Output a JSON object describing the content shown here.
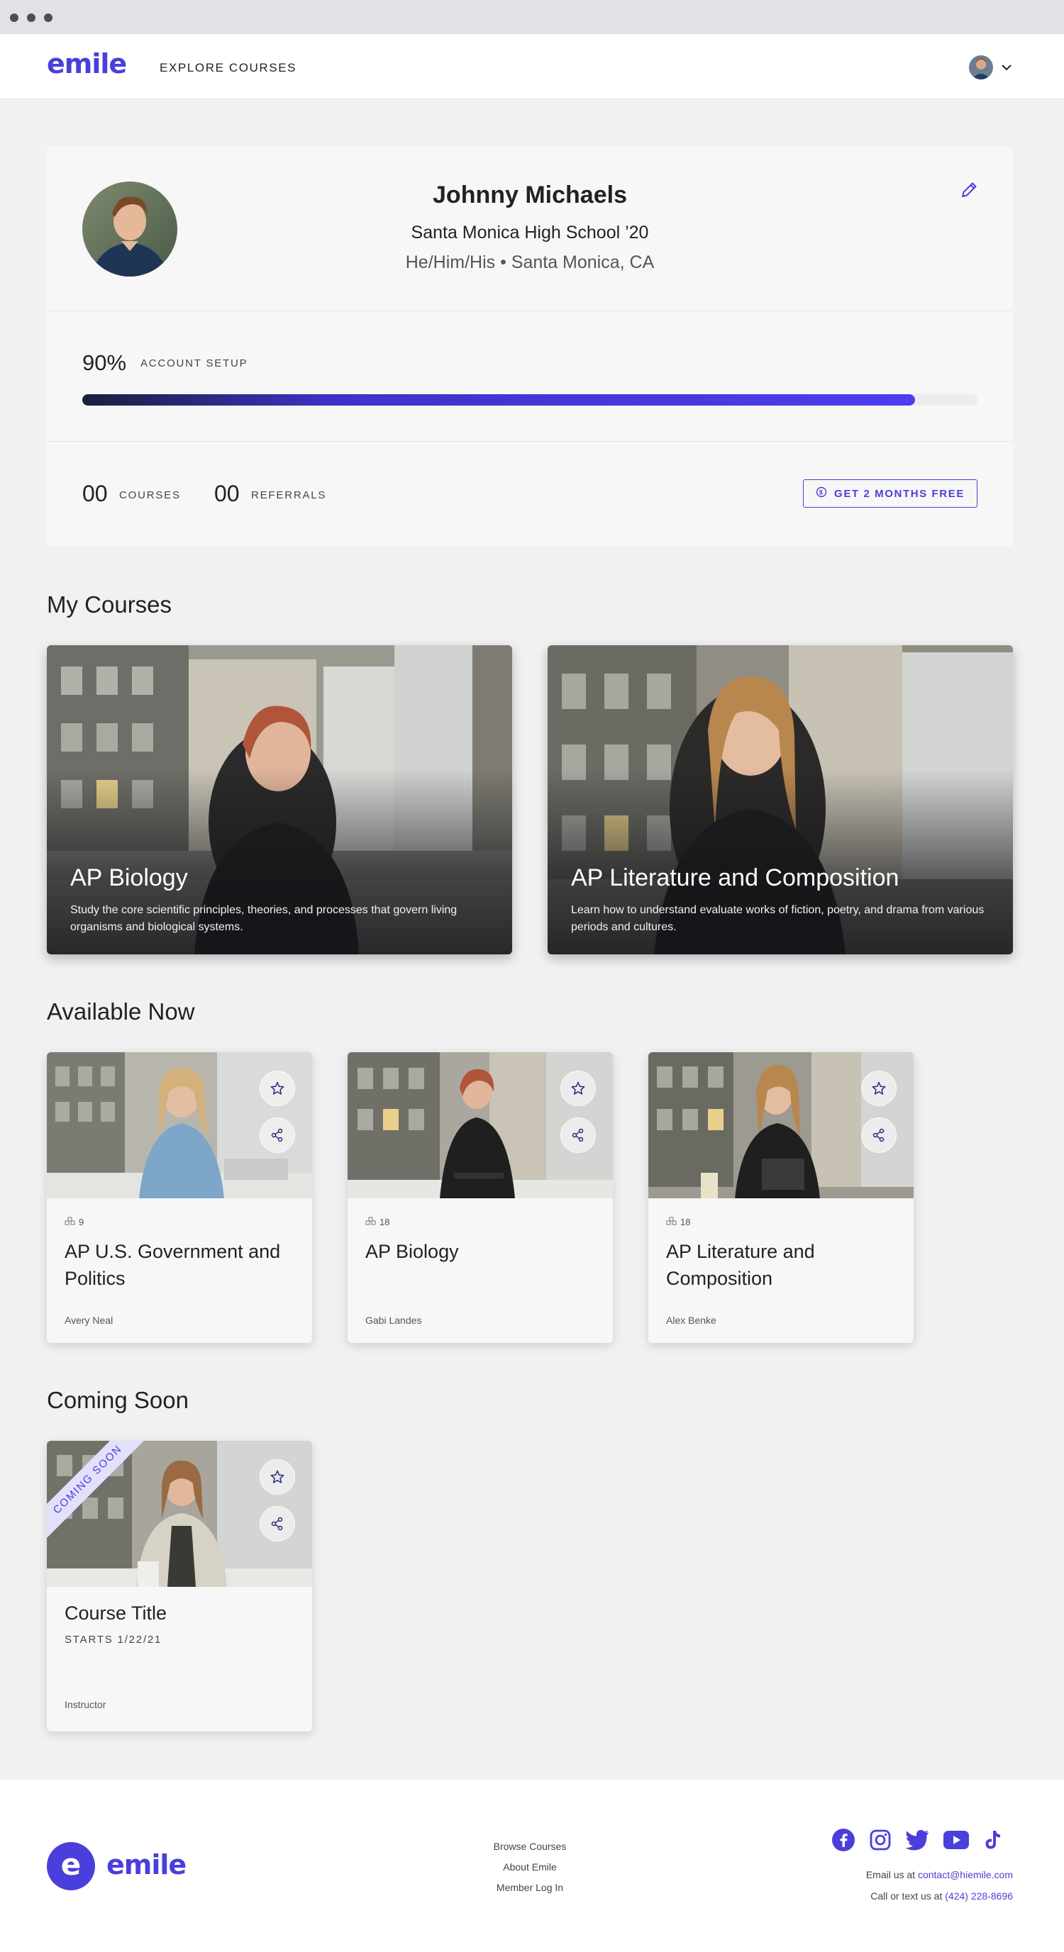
{
  "header": {
    "logo": "emile",
    "explore_label": "EXPLORE COURSES"
  },
  "profile": {
    "name": "Johnny Michaels",
    "school": "Santa Monica High School ’20",
    "pronouns_location": "He/Him/His • Santa Monica, CA",
    "setup_percent_label": "90%",
    "setup_percent": 0.93,
    "setup_label": "ACCOUNT SETUP",
    "courses_count": "00",
    "courses_label": "COURSES",
    "referrals_count": "00",
    "referrals_label": "REFERRALS",
    "free_button": "GET 2 MONTHS FREE"
  },
  "sections": {
    "my_courses": "My Courses",
    "available_now": "Available Now",
    "coming_soon": "Coming Soon"
  },
  "my_courses": [
    {
      "title": "AP Biology",
      "description": "Study the core scientific principles, theories, and processes that govern living organisms and biological systems."
    },
    {
      "title": "AP Literature and Composition",
      "description": "Learn how to understand evaluate works of fiction, poetry, and drama from various periods and cultures."
    }
  ],
  "available": [
    {
      "count": "9",
      "title": "AP U.S. Government and Politics",
      "instructor": "Avery Neal"
    },
    {
      "count": "18",
      "title": "AP Biology",
      "instructor": "Gabi Landes"
    },
    {
      "count": "18",
      "title": "AP Literature and Composition",
      "instructor": "Alex Benke"
    }
  ],
  "coming": [
    {
      "ribbon": "COMING SOON",
      "title": "Course Title",
      "starts": "STARTS 1/22/21",
      "instructor": "Instructor"
    }
  ],
  "footer": {
    "logo_mark": "e",
    "logo": "emile",
    "links": [
      "Browse Courses",
      "About Emile",
      "Member Log In"
    ],
    "social": [
      "facebook-icon",
      "instagram-icon",
      "twitter-icon",
      "youtube-icon",
      "tiktok-icon"
    ],
    "email_prefix": "Email us at ",
    "email": "contact@hiemile.com",
    "phone_prefix": "Call or text us at ",
    "phone": "(424) 228-8696"
  },
  "colors": {
    "brand": "#4a3fdb",
    "background": "#f1f1f1",
    "card": "#f7f7f7"
  }
}
